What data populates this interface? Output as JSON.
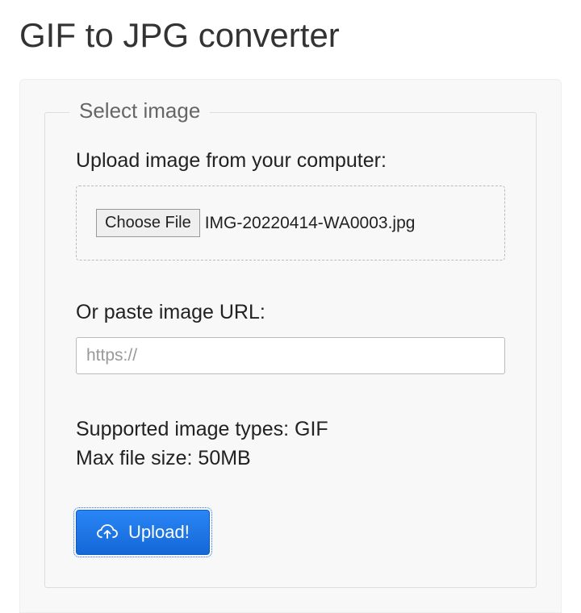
{
  "header": {
    "title": "GIF to JPG converter"
  },
  "form": {
    "legend": "Select image",
    "upload_label": "Upload image from your computer:",
    "choose_file_label": "Choose File",
    "selected_file_name": "IMG-20220414-WA0003.jpg",
    "url_label": "Or paste image URL:",
    "url_placeholder": "https://",
    "supported_types_text": "Supported image types: GIF",
    "max_size_text": "Max file size: 50MB",
    "upload_button_label": "Upload!"
  }
}
